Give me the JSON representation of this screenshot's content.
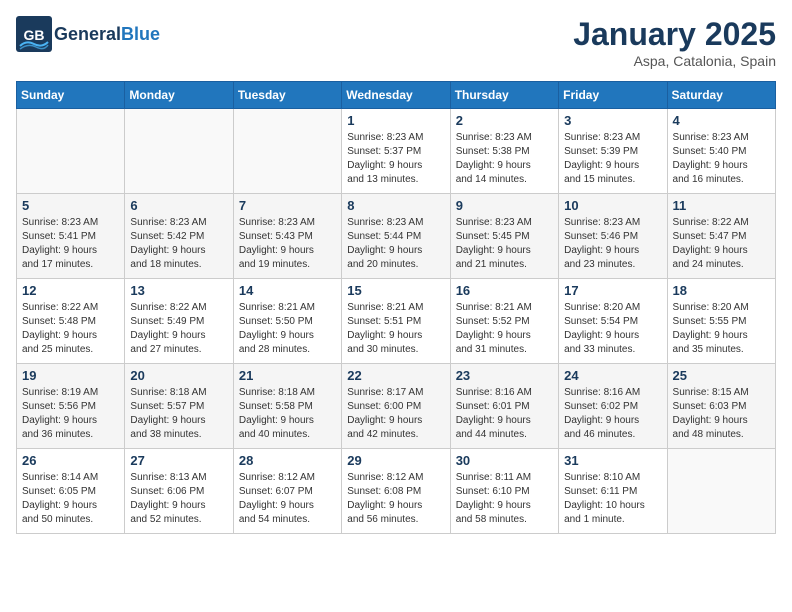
{
  "header": {
    "logo_general": "General",
    "logo_blue": "Blue",
    "month": "January 2025",
    "location": "Aspa, Catalonia, Spain"
  },
  "days_of_week": [
    "Sunday",
    "Monday",
    "Tuesday",
    "Wednesday",
    "Thursday",
    "Friday",
    "Saturday"
  ],
  "weeks": [
    [
      {
        "day": "",
        "info": ""
      },
      {
        "day": "",
        "info": ""
      },
      {
        "day": "",
        "info": ""
      },
      {
        "day": "1",
        "info": "Sunrise: 8:23 AM\nSunset: 5:37 PM\nDaylight: 9 hours\nand 13 minutes."
      },
      {
        "day": "2",
        "info": "Sunrise: 8:23 AM\nSunset: 5:38 PM\nDaylight: 9 hours\nand 14 minutes."
      },
      {
        "day": "3",
        "info": "Sunrise: 8:23 AM\nSunset: 5:39 PM\nDaylight: 9 hours\nand 15 minutes."
      },
      {
        "day": "4",
        "info": "Sunrise: 8:23 AM\nSunset: 5:40 PM\nDaylight: 9 hours\nand 16 minutes."
      }
    ],
    [
      {
        "day": "5",
        "info": "Sunrise: 8:23 AM\nSunset: 5:41 PM\nDaylight: 9 hours\nand 17 minutes."
      },
      {
        "day": "6",
        "info": "Sunrise: 8:23 AM\nSunset: 5:42 PM\nDaylight: 9 hours\nand 18 minutes."
      },
      {
        "day": "7",
        "info": "Sunrise: 8:23 AM\nSunset: 5:43 PM\nDaylight: 9 hours\nand 19 minutes."
      },
      {
        "day": "8",
        "info": "Sunrise: 8:23 AM\nSunset: 5:44 PM\nDaylight: 9 hours\nand 20 minutes."
      },
      {
        "day": "9",
        "info": "Sunrise: 8:23 AM\nSunset: 5:45 PM\nDaylight: 9 hours\nand 21 minutes."
      },
      {
        "day": "10",
        "info": "Sunrise: 8:23 AM\nSunset: 5:46 PM\nDaylight: 9 hours\nand 23 minutes."
      },
      {
        "day": "11",
        "info": "Sunrise: 8:22 AM\nSunset: 5:47 PM\nDaylight: 9 hours\nand 24 minutes."
      }
    ],
    [
      {
        "day": "12",
        "info": "Sunrise: 8:22 AM\nSunset: 5:48 PM\nDaylight: 9 hours\nand 25 minutes."
      },
      {
        "day": "13",
        "info": "Sunrise: 8:22 AM\nSunset: 5:49 PM\nDaylight: 9 hours\nand 27 minutes."
      },
      {
        "day": "14",
        "info": "Sunrise: 8:21 AM\nSunset: 5:50 PM\nDaylight: 9 hours\nand 28 minutes."
      },
      {
        "day": "15",
        "info": "Sunrise: 8:21 AM\nSunset: 5:51 PM\nDaylight: 9 hours\nand 30 minutes."
      },
      {
        "day": "16",
        "info": "Sunrise: 8:21 AM\nSunset: 5:52 PM\nDaylight: 9 hours\nand 31 minutes."
      },
      {
        "day": "17",
        "info": "Sunrise: 8:20 AM\nSunset: 5:54 PM\nDaylight: 9 hours\nand 33 minutes."
      },
      {
        "day": "18",
        "info": "Sunrise: 8:20 AM\nSunset: 5:55 PM\nDaylight: 9 hours\nand 35 minutes."
      }
    ],
    [
      {
        "day": "19",
        "info": "Sunrise: 8:19 AM\nSunset: 5:56 PM\nDaylight: 9 hours\nand 36 minutes."
      },
      {
        "day": "20",
        "info": "Sunrise: 8:18 AM\nSunset: 5:57 PM\nDaylight: 9 hours\nand 38 minutes."
      },
      {
        "day": "21",
        "info": "Sunrise: 8:18 AM\nSunset: 5:58 PM\nDaylight: 9 hours\nand 40 minutes."
      },
      {
        "day": "22",
        "info": "Sunrise: 8:17 AM\nSunset: 6:00 PM\nDaylight: 9 hours\nand 42 minutes."
      },
      {
        "day": "23",
        "info": "Sunrise: 8:16 AM\nSunset: 6:01 PM\nDaylight: 9 hours\nand 44 minutes."
      },
      {
        "day": "24",
        "info": "Sunrise: 8:16 AM\nSunset: 6:02 PM\nDaylight: 9 hours\nand 46 minutes."
      },
      {
        "day": "25",
        "info": "Sunrise: 8:15 AM\nSunset: 6:03 PM\nDaylight: 9 hours\nand 48 minutes."
      }
    ],
    [
      {
        "day": "26",
        "info": "Sunrise: 8:14 AM\nSunset: 6:05 PM\nDaylight: 9 hours\nand 50 minutes."
      },
      {
        "day": "27",
        "info": "Sunrise: 8:13 AM\nSunset: 6:06 PM\nDaylight: 9 hours\nand 52 minutes."
      },
      {
        "day": "28",
        "info": "Sunrise: 8:12 AM\nSunset: 6:07 PM\nDaylight: 9 hours\nand 54 minutes."
      },
      {
        "day": "29",
        "info": "Sunrise: 8:12 AM\nSunset: 6:08 PM\nDaylight: 9 hours\nand 56 minutes."
      },
      {
        "day": "30",
        "info": "Sunrise: 8:11 AM\nSunset: 6:10 PM\nDaylight: 9 hours\nand 58 minutes."
      },
      {
        "day": "31",
        "info": "Sunrise: 8:10 AM\nSunset: 6:11 PM\nDaylight: 10 hours\nand 1 minute."
      },
      {
        "day": "",
        "info": ""
      }
    ]
  ]
}
